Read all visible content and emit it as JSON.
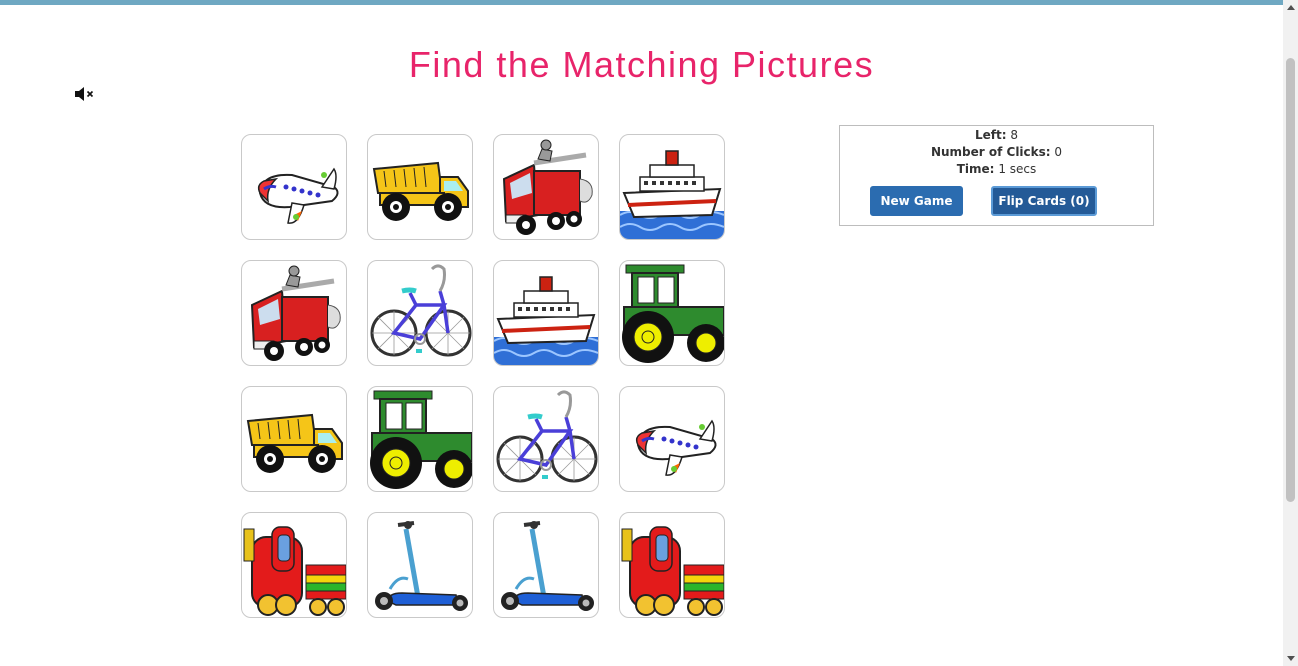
{
  "header": {
    "title": "Find the Matching Pictures"
  },
  "sound": {
    "icon": "speaker-muted-icon",
    "muted": true
  },
  "board": {
    "rows": 4,
    "cols": 4,
    "cards": [
      "airplane",
      "dump-truck",
      "fire-truck",
      "cruise-ship",
      "fire-truck",
      "bicycle",
      "cruise-ship",
      "tractor",
      "dump-truck",
      "tractor",
      "bicycle",
      "airplane",
      "train",
      "scooter",
      "scooter",
      "train"
    ]
  },
  "stats": {
    "left_label": "Left:",
    "left_value": "8",
    "clicks_label": "Number of Clicks:",
    "clicks_value": "0",
    "time_label": "Time:",
    "time_value": "1 secs"
  },
  "buttons": {
    "new_game": "New Game",
    "flip_cards": "Flip Cards (0)"
  },
  "colors": {
    "title": "#e8246a",
    "button": "#2b6cb0",
    "top_bar": "#6fa8c2"
  }
}
